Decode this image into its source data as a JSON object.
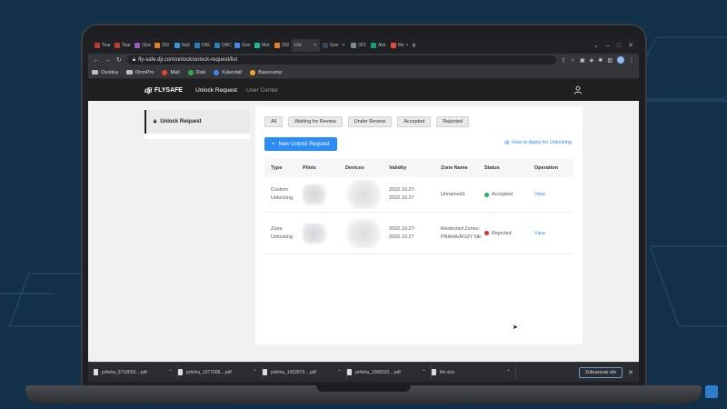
{
  "browser": {
    "tabs": [
      {
        "label": "Tear",
        "color": "#c0392b"
      },
      {
        "label": "Tear",
        "color": "#c0392b"
      },
      {
        "label": "(Soc",
        "color": "#9b59b6"
      },
      {
        "label": "202",
        "color": "#e67e22"
      },
      {
        "label": "Nejl",
        "color": "#3498db"
      },
      {
        "label": "DRL",
        "color": "#2980b9"
      },
      {
        "label": "DRC",
        "color": "#2980b9"
      },
      {
        "label": "Goo",
        "color": "#4285f4"
      },
      {
        "label": "Mot",
        "color": "#1abc9c"
      },
      {
        "label": "202",
        "color": "#e67e22"
      },
      {
        "label": "Unl",
        "color": "#222222"
      },
      {
        "label": "Geo",
        "color": "#34495e"
      },
      {
        "label": "3D1",
        "color": "#7f8c8d"
      },
      {
        "label": "Alst",
        "color": "#16a085"
      },
      {
        "label": "file",
        "color": "#e74c3c"
      }
    ],
    "url": "fly-safe.dji.com/unlock/unlock-request/list",
    "avatar_letter": "A",
    "bookmarks": [
      {
        "label": "Osobka",
        "type": "folder"
      },
      {
        "label": "DronPro",
        "type": "folder"
      },
      {
        "label": "Mail",
        "type": "icon",
        "color": "#ea4335"
      },
      {
        "label": "Disk",
        "type": "icon",
        "color": "#34a853"
      },
      {
        "label": "Kalendář",
        "type": "icon",
        "color": "#4285f4"
      },
      {
        "label": "Basecamp",
        "type": "icon",
        "color": "#f4a623"
      }
    ]
  },
  "app": {
    "logo_text": "FLYSAFE",
    "logo_mark": "dji",
    "nav": [
      "Unlock Request",
      "User Center"
    ],
    "sidebar_item": "Unlock Request",
    "filters": [
      "All",
      "Waiting for Review",
      "Under Review",
      "Accepted",
      "Rejected"
    ],
    "new_button": "New Unlock Request",
    "howto_link": "How to Apply for Unlocking",
    "table": {
      "headers": [
        "Type",
        "Pilots",
        "Devices",
        "Validity",
        "Zone Name",
        "Status",
        "Operation"
      ],
      "rows": [
        {
          "type": "Custom Unlocking",
          "validity_1": "2022.10.27-",
          "validity_2": "2022.10.27",
          "zone": "Unnamed1",
          "status": "Accepted",
          "status_color": "#27ae60",
          "op": "View"
        },
        {
          "type": "Zone Unlocking",
          "validity_1": "2022.10.27-",
          "validity_2": "2022.10.27",
          "zone": "Restricted Zones: PRAHA/RUZY NE",
          "status": "Rejected",
          "status_color": "#e03131",
          "op": "View"
        }
      ]
    }
  },
  "downloads": {
    "items": [
      "priloha_9718093....pdf",
      "priloha_1077008....pdf",
      "priloha_1002879....pdf",
      "priloha_1068320....pdf",
      "file.xlsx"
    ],
    "show_all": "Zobrazovat vše"
  }
}
